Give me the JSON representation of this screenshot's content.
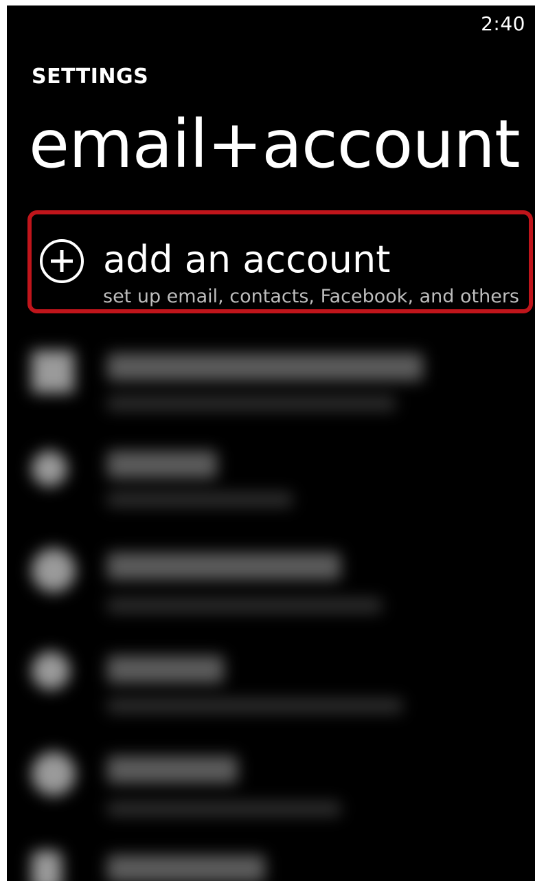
{
  "status_bar": {
    "time": "2:40"
  },
  "header": {
    "section": "SETTINGS",
    "title": "email+account"
  },
  "add_account": {
    "icon": "plus-circle-icon",
    "label": "add an account",
    "description": "set up email, contacts, Facebook, and others",
    "highlight_color": "#c0151b"
  },
  "accounts": [
    {
      "icon": "account-icon"
    },
    {
      "icon": "account-icon"
    },
    {
      "icon": "account-icon"
    },
    {
      "icon": "account-icon"
    },
    {
      "icon": "account-icon"
    },
    {
      "icon": "account-icon"
    }
  ],
  "colors": {
    "background": "#000000",
    "text": "#ffffff",
    "subtext": "#bdbdbd"
  }
}
